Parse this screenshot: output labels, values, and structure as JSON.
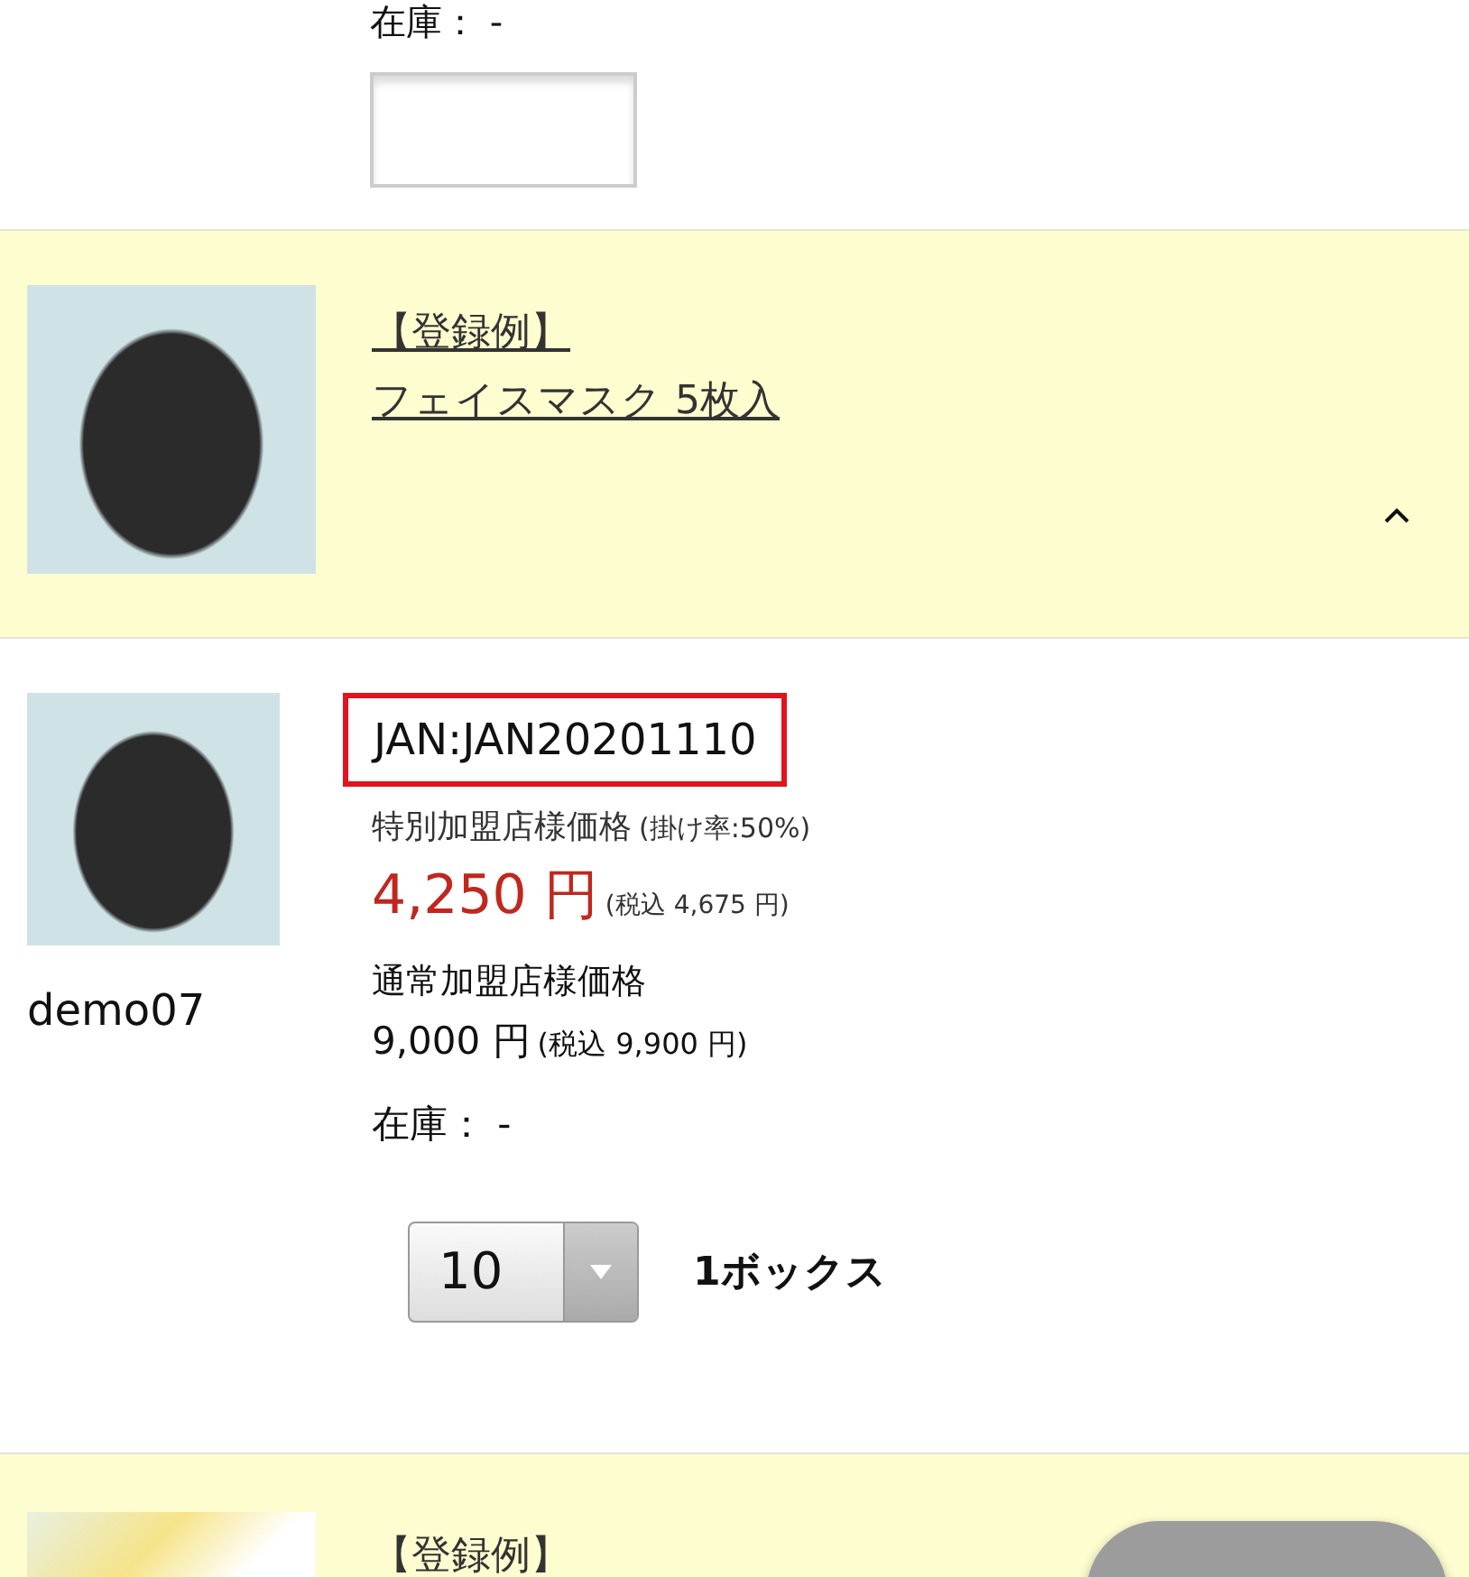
{
  "top_item": {
    "stock_label": "在庫：",
    "stock_value": "-"
  },
  "product_header": {
    "title_lines": [
      "【登録例】",
      "フェイスマスク 5枚入"
    ],
    "expanded": true
  },
  "product_detail": {
    "code": "demo07",
    "jan": "JAN:JAN20201110",
    "special_price_label": "特別加盟店様価格",
    "rate": "(掛け率:50%)",
    "special_price": "4,250 円",
    "special_price_tax": "(税込 4,675 円)",
    "normal_price_label": "通常加盟店様価格",
    "normal_price": "9,000 円",
    "normal_price_tax": "(税込 9,900 円)",
    "stock_label": "在庫：",
    "stock_value": "-",
    "quantity": "10",
    "unit": "1ボックス"
  },
  "next_header": {
    "title_lines": [
      "【登録例】"
    ]
  }
}
